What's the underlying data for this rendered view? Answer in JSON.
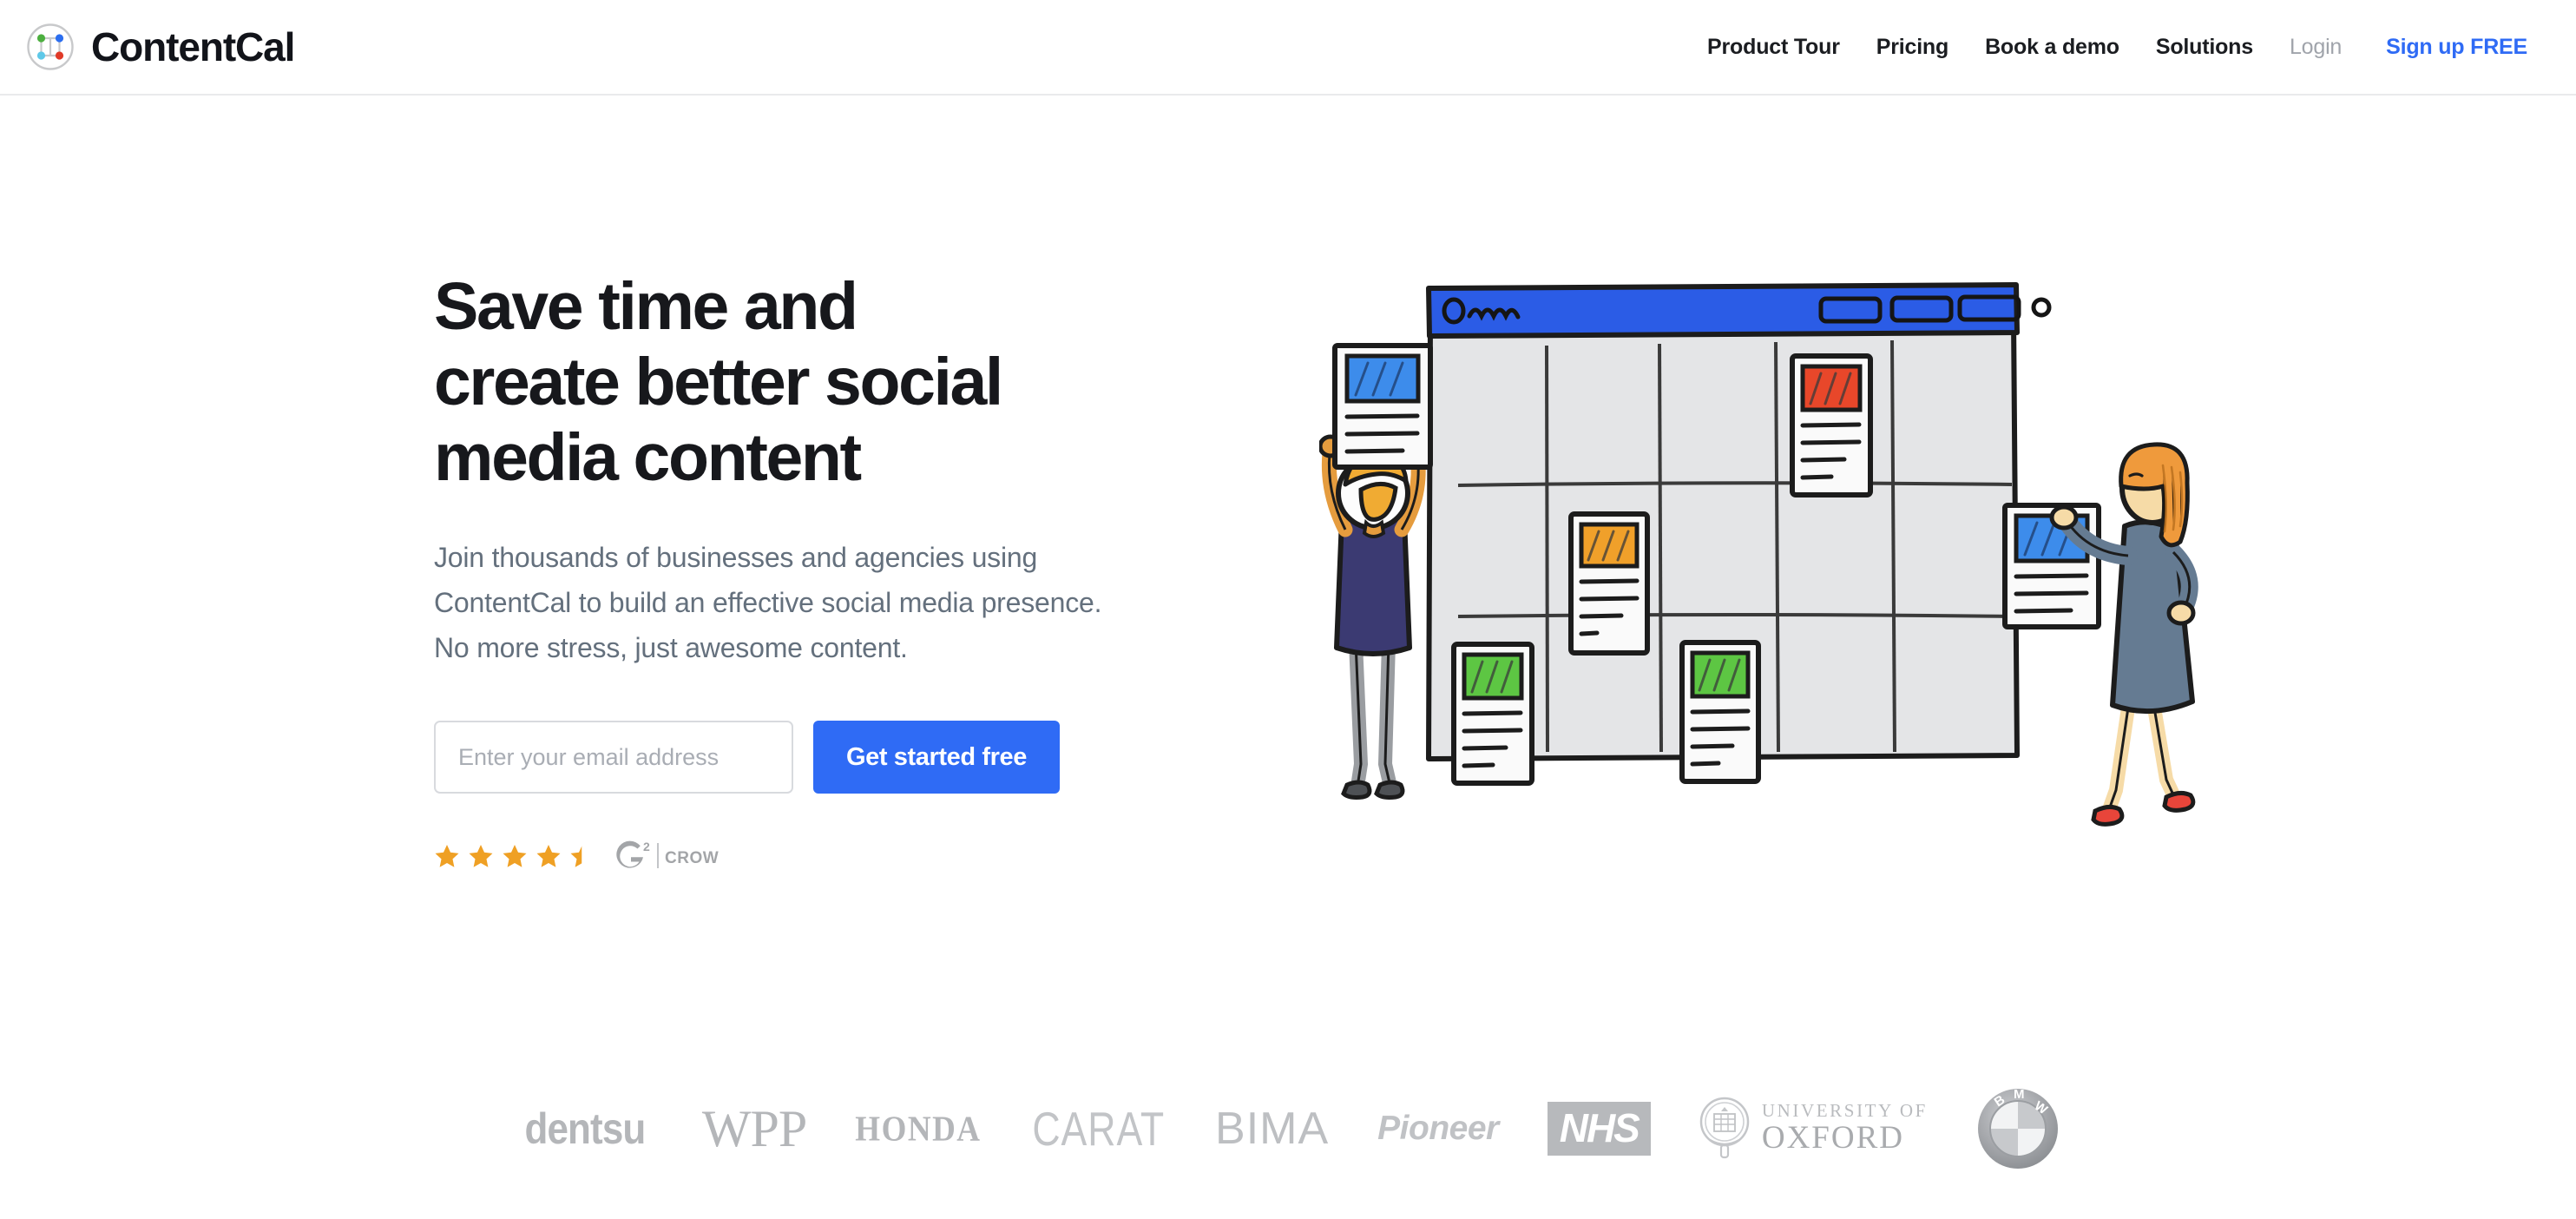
{
  "brand": {
    "name": "ContentCal",
    "logo_colors": {
      "top_left_dot": "#4caf3f",
      "top_right_dot": "#2b6ef0",
      "bottom_left_dot": "#5ec8e8",
      "bottom_right_dot": "#e03a28",
      "ring": "#c8c9cb"
    }
  },
  "nav": {
    "items": [
      {
        "label": "Product Tour",
        "style": "default"
      },
      {
        "label": "Pricing",
        "style": "default"
      },
      {
        "label": "Book a demo",
        "style": "default"
      },
      {
        "label": "Solutions",
        "style": "default"
      },
      {
        "label": "Login",
        "style": "muted"
      },
      {
        "label": "Sign up FREE",
        "style": "accent"
      }
    ]
  },
  "hero": {
    "headline_line1": "Save time and",
    "headline_line2": "create better social",
    "headline_line3": "media content",
    "subheadline": "Join thousands of businesses and agencies using ContentCal to build an effective social media presence. No more stress, just awesome content.",
    "email_placeholder": "Enter your email address",
    "email_value": "",
    "cta_label": "Get started free",
    "rating": {
      "value": 4.5,
      "max": 5,
      "full_stars": 4,
      "half_stars": 1,
      "star_color": "#efa024",
      "source_primary": "G",
      "source_superscript": "2",
      "source_secondary": "CROWD"
    },
    "accent_color": "#2f6bf5"
  },
  "illustration": {
    "name": "content-calendar-board-illustration",
    "board_header_color": "#2b5ce6",
    "board_body_color": "#e4e5e7",
    "cards": [
      {
        "row": 1,
        "col": 4,
        "color": "#e8472a"
      },
      {
        "row": 2,
        "col": 2,
        "color": "#f0a02a"
      },
      {
        "row": 3,
        "col": 1,
        "color": "#5dc643"
      },
      {
        "row": 3,
        "col": 2,
        "color": "#5dc643"
      }
    ],
    "held_cards": [
      {
        "holder": "man-left",
        "color": "#3d8ceb"
      },
      {
        "holder": "woman-right",
        "color": "#3d8ceb"
      }
    ],
    "people": [
      {
        "name": "man-left",
        "shirt": "#3b3a72",
        "trousers": "#9a9da1",
        "hair": "#f0ab33",
        "shoes": "#4e5155"
      },
      {
        "name": "woman-right",
        "dress": "#657b92",
        "hair": "#ef9a3c",
        "shoes": "#e8453a",
        "skin": "#f6dba7"
      }
    ]
  },
  "logos": {
    "heading": "",
    "items": [
      {
        "name": "dentsu",
        "label": "dentsu",
        "style": "dentsu"
      },
      {
        "name": "wpp",
        "label": "WPP",
        "style": "wpp"
      },
      {
        "name": "honda",
        "label": "HONDA",
        "style": "honda"
      },
      {
        "name": "carat",
        "label": "CARAT",
        "style": "carat"
      },
      {
        "name": "bima",
        "label": "BIMA",
        "style": "bima"
      },
      {
        "name": "pioneer",
        "label": "Pioneer",
        "style": "pioneer"
      },
      {
        "name": "nhs",
        "label": "NHS",
        "style": "nhs"
      },
      {
        "name": "oxford",
        "label_line1": "UNIVERSITY OF",
        "label_line2": "OXFORD",
        "style": "oxford"
      },
      {
        "name": "bmw",
        "label": "BMW",
        "style": "bmw"
      }
    ],
    "greyscale_color": "#b7b9bc"
  }
}
